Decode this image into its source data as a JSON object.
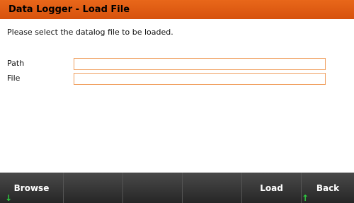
{
  "title": "Data Logger - Load File",
  "instruction": "Please select the datalog file to be loaded.",
  "fields": {
    "path": {
      "label": "Path",
      "value": ""
    },
    "file": {
      "label": "File",
      "value": ""
    }
  },
  "softkeys": [
    "Browse",
    "",
    "",
    "",
    "Load",
    "Back"
  ],
  "colors": {
    "title_bar": "#e0601a",
    "field_border": "#f0a060",
    "softkey_bar": "#333333",
    "arrow": "#2ecc40"
  },
  "icons": {
    "browse": "arrow-down-icon",
    "back": "arrow-up-icon"
  }
}
